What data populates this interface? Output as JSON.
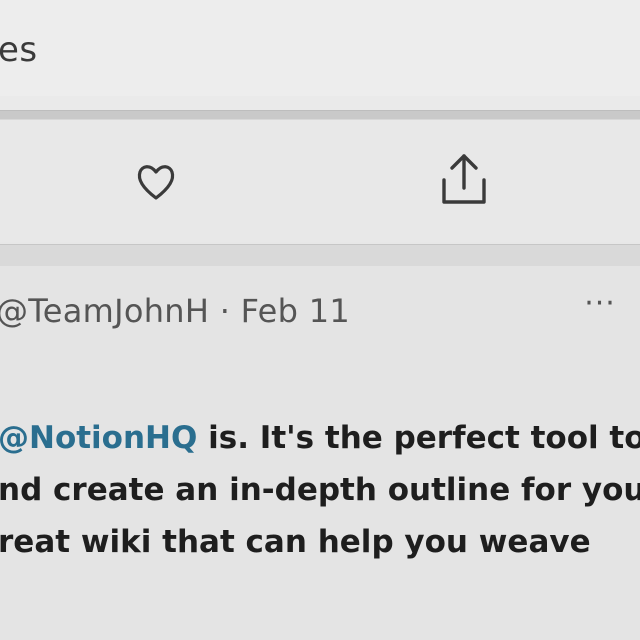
{
  "previous_tweet": {
    "text_fragment": "es"
  },
  "actions": {
    "like_icon": "heart-icon",
    "share_icon": "share-upload-icon"
  },
  "tweet": {
    "handle": "@TeamJohnH",
    "separator": "·",
    "date": "Feb 11",
    "more_label": "···",
    "line1_mention": "@NotionHQ",
    "line1_rest": " is. It's the perfect tool to",
    "line2": "nd create an in-depth outline for your",
    "line3": "reat wiki that can help you weave"
  },
  "colors": {
    "mention": "#2a6e8f",
    "text": "#1e1e1e",
    "muted": "#555555"
  }
}
